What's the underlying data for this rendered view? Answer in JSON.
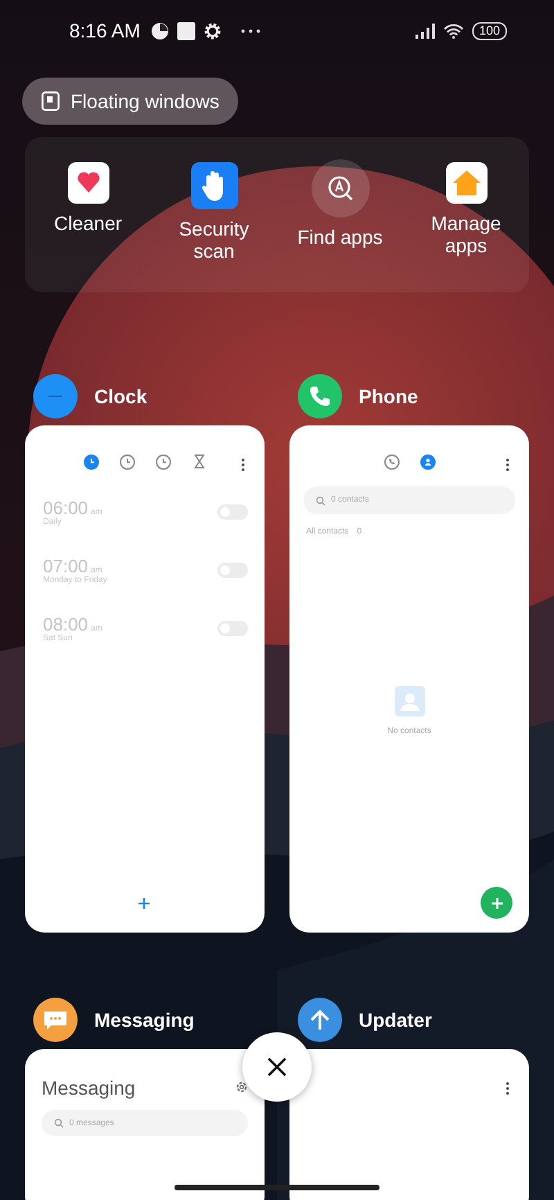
{
  "status_bar": {
    "time": "8:16 AM",
    "battery": "100"
  },
  "floating_button": {
    "label": "Floating windows"
  },
  "shortcuts": [
    {
      "kind": "cleaner",
      "label": "Cleaner"
    },
    {
      "kind": "security",
      "label": "Security scan"
    },
    {
      "kind": "find",
      "label": "Find apps"
    },
    {
      "kind": "manage",
      "label": "Manage apps"
    }
  ],
  "apps": [
    {
      "kind": "clock",
      "name": "Clock",
      "tabs": [
        {
          "kind": "alarm",
          "selected": true
        },
        {
          "kind": "clock",
          "selected": false
        },
        {
          "kind": "stopwatch",
          "selected": false
        },
        {
          "kind": "timer",
          "selected": false
        }
      ],
      "alarms": [
        {
          "time": "06:00",
          "suffix": "am",
          "repeat": "Daily",
          "on": false
        },
        {
          "time": "07:00",
          "suffix": "am",
          "repeat": "Monday to Friday",
          "on": false
        },
        {
          "time": "08:00",
          "suffix": "am",
          "repeat": "Sat Sun",
          "on": false
        }
      ]
    },
    {
      "kind": "phone",
      "name": "Phone",
      "tabs": [
        {
          "kind": "recents",
          "selected": false
        },
        {
          "kind": "contacts",
          "selected": true
        }
      ],
      "search": {
        "placeholder": "0 contacts"
      },
      "section": "All contacts",
      "count": "0",
      "empty": "No contacts"
    },
    {
      "kind": "messaging",
      "name": "Messaging",
      "title": "Messaging",
      "search": {
        "placeholder": "0 messages"
      }
    },
    {
      "kind": "updater",
      "name": "Updater"
    }
  ]
}
